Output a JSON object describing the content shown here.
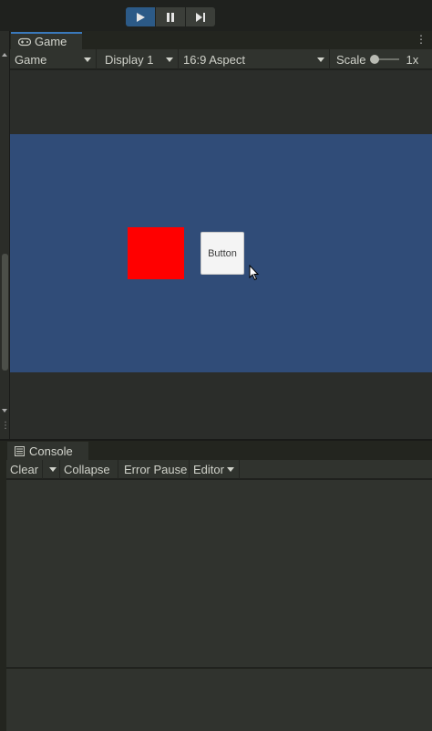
{
  "toolbar": {
    "play": "play-icon",
    "pause": "pause-icon",
    "step": "step-icon"
  },
  "game_window": {
    "tab_label": "Game",
    "tab_icon": "gamepad-icon",
    "display_mode": "Game",
    "display": "Display 1",
    "aspect": "16:9 Aspect",
    "scale_label": "Scale",
    "scale_value": "1x",
    "scene": {
      "button_label": "Button"
    }
  },
  "console_window": {
    "tab_label": "Console",
    "tab_icon": "console-icon",
    "clear_label": "Clear",
    "collapse_label": "Collapse",
    "error_pause_label": "Error Pause",
    "editor_label": "Editor"
  },
  "colors": {
    "accent": "#2c5a87",
    "scene_background": "#304c78",
    "red_square": "#ff0000"
  }
}
